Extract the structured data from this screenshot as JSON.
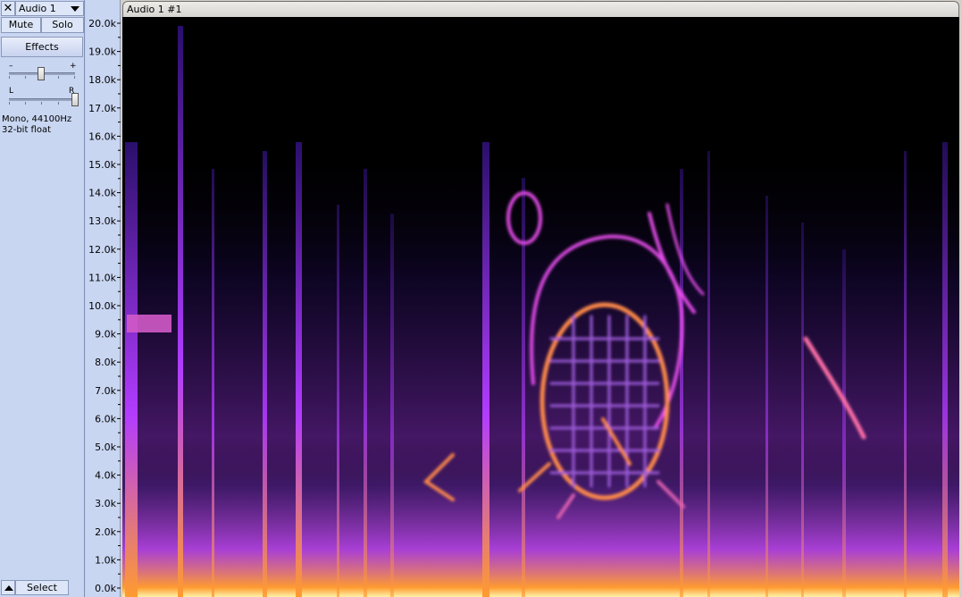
{
  "track": {
    "close_glyph": "✕",
    "name": "Audio 1",
    "mute_label": "Mute",
    "solo_label": "Solo",
    "effects_label": "Effects",
    "gain_minus": "–",
    "gain_plus": "+",
    "pan_left": "L",
    "pan_right": "R",
    "format_line1": "Mono, 44100Hz",
    "format_line2": "32-bit float",
    "select_label": "Select"
  },
  "clip": {
    "name": "Audio 1 #1"
  },
  "ruler": {
    "labels": [
      "20.0k",
      "19.0k",
      "18.0k",
      "17.0k",
      "16.0k",
      "15.0k",
      "14.0k",
      "13.0k",
      "12.0k",
      "11.0k",
      "10.0k",
      "9.0k",
      "8.0k",
      "7.0k",
      "6.0k",
      "5.0k",
      "4.0k",
      "3.0k",
      "2.0k",
      "1.0k",
      "0.0k"
    ]
  },
  "colors": {
    "panel_bg": "#c9d6f2",
    "spectrogram_bg": "#000000",
    "spectrogram_low": "#2a0f6b",
    "spectrogram_mid": "#b23cff",
    "spectrogram_high": "#ff9b2f",
    "spectrogram_peak": "#fff2a8"
  },
  "icons": {
    "close": "close-icon",
    "menu": "dropdown-arrow-icon",
    "collapse": "collapse-arrow-icon"
  }
}
